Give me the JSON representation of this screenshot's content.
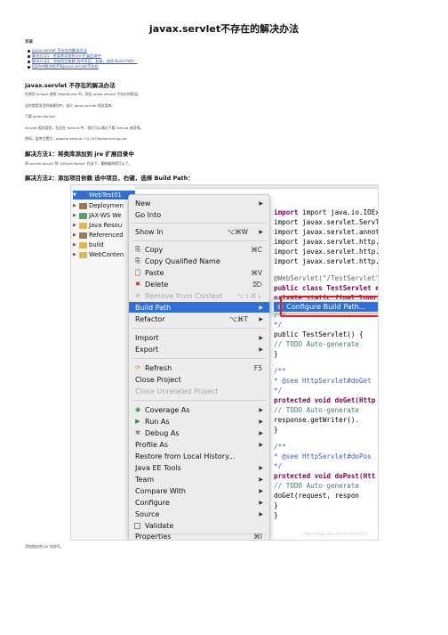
{
  "page": {
    "title": "javax.servlet不存在的解决办法",
    "toc_heading": "目录",
    "toc": [
      "javax.servlet 不存在的解决办法",
      "解决方法1：将类库添加到 jre 扩展目录中",
      "解决方法2：添加项目依赖 选中项目，右键，选择 Build Path：",
      "IDEA中解决找不到javax.servlet不存在"
    ],
    "section1": {
      "heading": "javax.servlet 不存在的解决办法",
      "lines": [
        "在使用 eclipse 使用 HttpServlet 时，报告 javax.servlet 不存在的错误。",
        "这时就是项目的依赖包中，缺少 javax.servlet 相关类库。",
        "下载 javax.servlet",
        "Servlet 相关类包，包含在 Tomcat 中，我们可以通过下载 Tomcat 来获得。",
        "例如，类库位置为：apache-tomcat-7.0.107/lib/servlet-api.jar"
      ]
    },
    "section2": {
      "heading": "解决方法1：将类库添加到 jre 扩展目录中",
      "line": "将 servlet-api.jar 到 \"JDK/jre/lib/ext\" 目录下，重新编译就可以了。"
    },
    "section3": {
      "heading": "解决方法2：添加项目依赖 选中项目，右键，选择 Build Path："
    },
    "footnote": "添加相应的 jar 包即可。",
    "watermark": "https://blog.csdn.net/m0_47405013"
  },
  "screenshot": {
    "tree": [
      {
        "label": "WebTest01",
        "arrow": "▼",
        "icon": "project-icon",
        "selected": true
      },
      {
        "label": "Deploymen",
        "arrow": "▶",
        "icon": "deployment-icon",
        "selected": false
      },
      {
        "label": "JAX-WS We",
        "arrow": "▶",
        "icon": "jaxws-icon",
        "selected": false
      },
      {
        "label": "Java Resou",
        "arrow": "▶",
        "icon": "java-resources-icon",
        "selected": false
      },
      {
        "label": "Referenced",
        "arrow": "▶",
        "icon": "referenced-libraries-icon",
        "selected": false
      },
      {
        "label": "build",
        "arrow": "▶",
        "icon": "folder-icon",
        "selected": false
      },
      {
        "label": "WebConten",
        "arrow": "▶",
        "icon": "folder-icon",
        "selected": false
      }
    ],
    "menu": {
      "new": "New",
      "go_into": "Go Into",
      "show_in": "Show In",
      "show_in_sc": "⌥⌘W",
      "copy": "Copy",
      "copy_sc": "⌘C",
      "copy_qualified": "Copy Qualified Name",
      "paste": "Paste",
      "paste_sc": "⌘V",
      "delete": "Delete",
      "delete_sc": "⌦",
      "remove_ctx": "Remove from Context",
      "remove_ctx_sc": "⌥⇧⌘↓",
      "build_path": "Build Path",
      "refactor": "Refactor",
      "refactor_sc": "⌥⌘T",
      "import": "Import",
      "export": "Export",
      "refresh": "Refresh",
      "refresh_sc": "F5",
      "close_project": "Close Project",
      "close_unrelated": "Close Unrelated Project",
      "coverage_as": "Coverage As",
      "run_as": "Run As",
      "debug_as": "Debug As",
      "profile_as": "Profile As",
      "restore_history": "Restore from Local History...",
      "javaee_tools": "Java EE Tools",
      "team": "Team",
      "compare_with": "Compare With",
      "configure": "Configure",
      "source": "Source",
      "validate": "Validate",
      "properties": "Properties",
      "properties_sc": "⌘I"
    },
    "submenu": {
      "configure_build_path": "Configure Build Path..."
    },
    "code": [
      "import java.io.IOException;",
      "import javax.servlet.ServletE",
      "import javax.servlet.annotati",
      "import javax.servlet.http.Htt",
      "import javax.servlet.http.Htt",
      "import javax.servlet.http.Htt",
      "@WebServlet(\"/TestServlet\")",
      "public class TestServlet exte",
      "    private static final long",
      "    /**",
      "     */",
      "    public TestServlet() {",
      "        // TODO Auto-generate",
      "    }",
      "    /**",
      "     * @see HttpServlet#doGet",
      "     */",
      "    protected void doGet(Http",
      "        // TODO Auto-generate",
      "        response.getWriter().",
      "    }",
      "    /**",
      "     * @see HttpServlet#doPos",
      "     */",
      "    protected void doPost(Htt",
      "        // TODO Auto-generate",
      "        doGet(request, respon",
      "    }",
      "}"
    ]
  }
}
